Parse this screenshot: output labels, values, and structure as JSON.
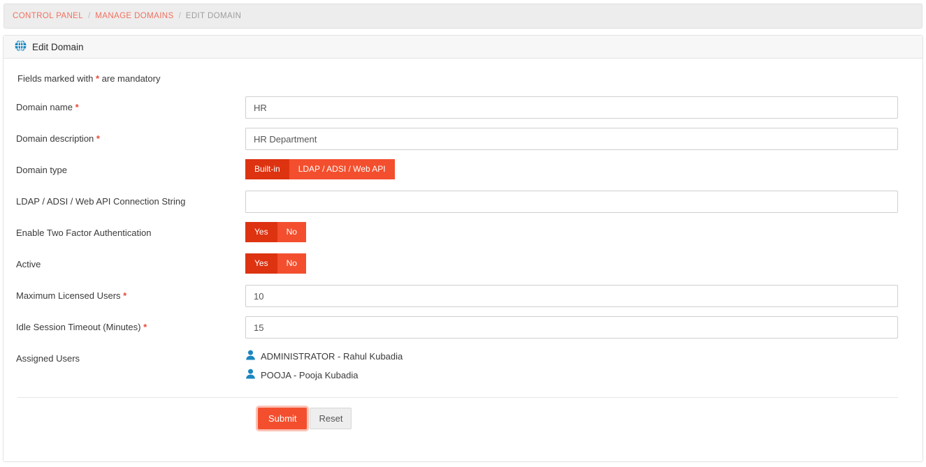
{
  "breadcrumb": {
    "items": [
      {
        "label": "CONTROL PANEL",
        "active": false
      },
      {
        "label": "MANAGE DOMAINS",
        "active": false
      },
      {
        "label": "EDIT DOMAIN",
        "active": true
      }
    ],
    "separator": "/"
  },
  "panel": {
    "icon": "globe-icon",
    "title": "Edit Domain",
    "mandatory_note_prefix": "Fields marked with ",
    "mandatory_marker": "*",
    "mandatory_note_suffix": " are mandatory"
  },
  "form": {
    "domain_name": {
      "label": "Domain name",
      "required_marker": "*",
      "value": "HR",
      "placeholder": ""
    },
    "domain_description": {
      "label": "Domain description",
      "required_marker": "*",
      "value": "HR Department",
      "placeholder": ""
    },
    "domain_type": {
      "label": "Domain type",
      "options": [
        {
          "label": "Built-in",
          "selected": true
        },
        {
          "label": "LDAP / ADSI / Web API",
          "selected": false
        }
      ]
    },
    "connection_string": {
      "label": "LDAP / ADSI / Web API Connection String",
      "value": "",
      "placeholder": ""
    },
    "two_factor": {
      "label": "Enable Two Factor Authentication",
      "options": [
        {
          "label": "Yes",
          "selected": true
        },
        {
          "label": "No",
          "selected": false
        }
      ]
    },
    "active": {
      "label": "Active",
      "options": [
        {
          "label": "Yes",
          "selected": true
        },
        {
          "label": "No",
          "selected": false
        }
      ]
    },
    "max_users": {
      "label": "Maximum Licensed Users",
      "required_marker": "*",
      "value": "10",
      "placeholder": ""
    },
    "idle_timeout": {
      "label": "Idle Session Timeout (Minutes)",
      "required_marker": "*",
      "value": "15",
      "placeholder": ""
    },
    "assigned_users": {
      "label": "Assigned Users",
      "users": [
        {
          "icon": "user-icon",
          "text": "ADMINISTRATOR - Rahul Kubadia"
        },
        {
          "icon": "user-icon",
          "text": "POOJA - Pooja Kubadia"
        }
      ]
    }
  },
  "actions": {
    "submit_label": "Submit",
    "reset_label": "Reset"
  },
  "colors": {
    "accent_red": "#f34f2e",
    "accent_red_dark": "#dd3311",
    "link_coral": "#f1705f",
    "icon_blue": "#1b87c0",
    "required_red": "#e8493a"
  }
}
